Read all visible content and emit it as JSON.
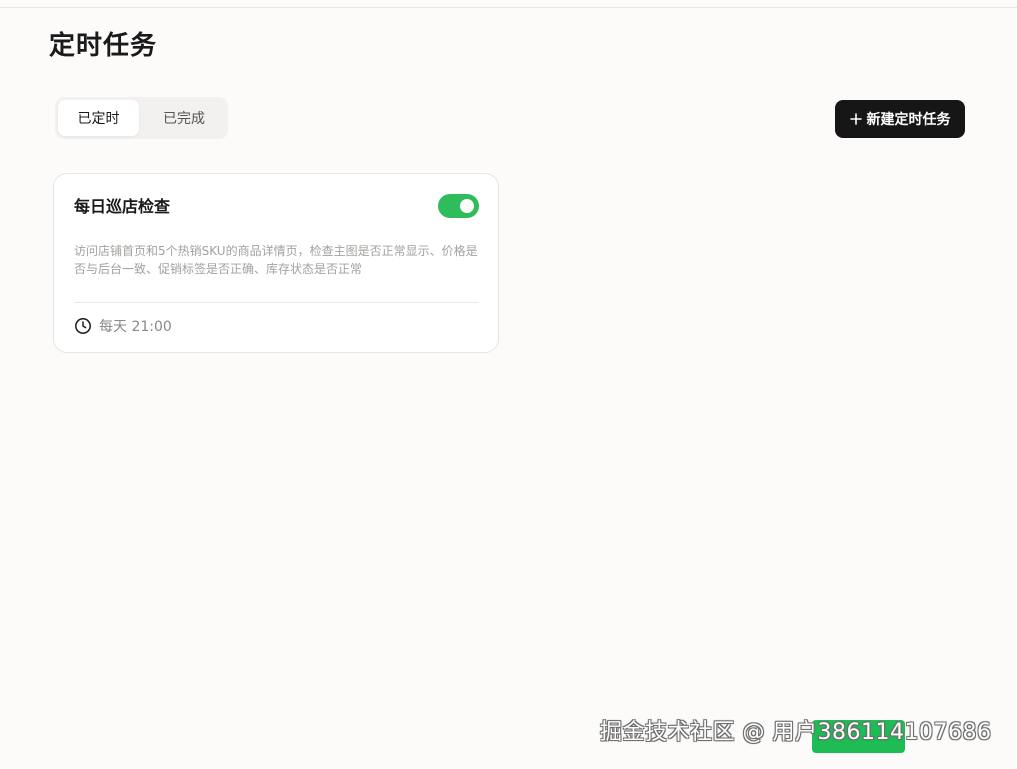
{
  "page": {
    "title": "定时任务"
  },
  "tabs": [
    {
      "label": "已定时",
      "active": true
    },
    {
      "label": "已完成",
      "active": false
    }
  ],
  "toolbar": {
    "new_task_label": "新建定时任务",
    "new_task_icon": "plus-icon"
  },
  "tasks": [
    {
      "title": "每日巡店检查",
      "enabled": true,
      "description": "访问店铺首页和5个热销SKU的商品详情页，检查主图是否正常显示、价格是否与后台一致、促销标签是否正确、库存状态是否正常",
      "schedule": "每天 21:00",
      "schedule_icon": "clock-icon"
    }
  ],
  "watermark": {
    "text": "掘金技术社区 @ 用户386114107686"
  },
  "colors": {
    "background": "#fcfbfa",
    "primary_button": "#161616",
    "toggle_on": "#2fbd5b",
    "text_primary": "#1a1a1a",
    "text_muted": "#a3a19e"
  }
}
